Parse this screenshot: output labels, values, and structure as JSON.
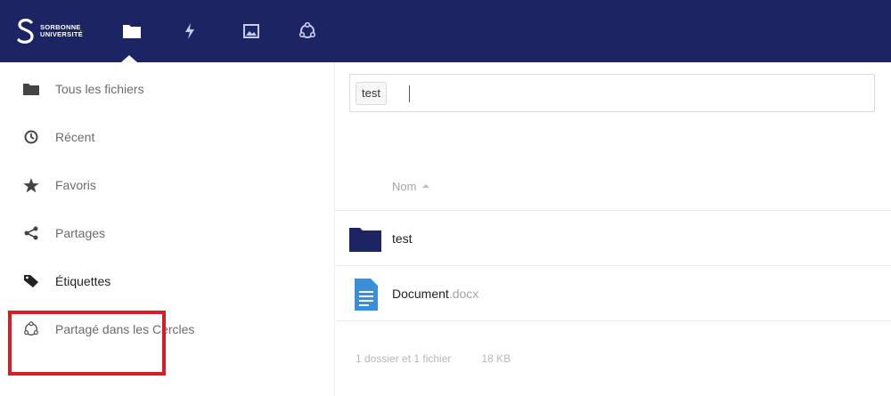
{
  "header": {
    "logo_line1": "SORBONNE",
    "logo_line2": "UNIVERSITÉ",
    "apps": [
      {
        "name": "files-icon"
      },
      {
        "name": "activity-icon"
      },
      {
        "name": "gallery-icon"
      },
      {
        "name": "circles-icon"
      }
    ],
    "background": "#1c2464"
  },
  "sidebar": {
    "items": [
      {
        "label": "Tous les fichiers",
        "icon": "folder-icon"
      },
      {
        "label": "Récent",
        "icon": "clock-icon"
      },
      {
        "label": "Favoris",
        "icon": "star-icon"
      },
      {
        "label": "Partages",
        "icon": "share-icon"
      },
      {
        "label": "Étiquettes",
        "icon": "tag-icon"
      },
      {
        "label": "Partagé dans les Cercles",
        "icon": "circles-icon"
      }
    ],
    "highlight_color": "#d41f26"
  },
  "filter": {
    "tag": "test"
  },
  "list": {
    "column_name": "Nom",
    "rows": [
      {
        "name": "test",
        "ext": "",
        "type": "folder"
      },
      {
        "name": "Document",
        "ext": ".docx",
        "type": "document"
      }
    ],
    "summary_count": "1 dossier et 1 fichier",
    "summary_size": "18 KB"
  },
  "colors": {
    "folder": "#1c2464",
    "document": "#3d8ed8"
  }
}
